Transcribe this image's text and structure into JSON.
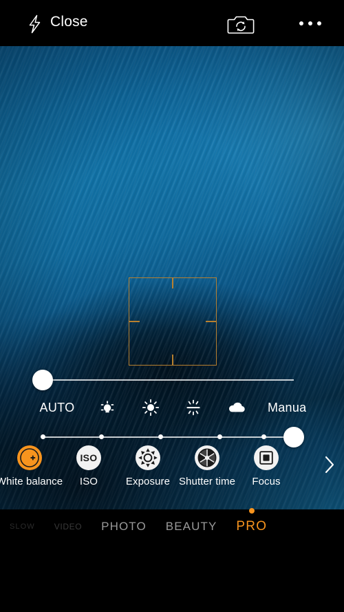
{
  "app": {
    "name": "Camera",
    "mode": "PRO",
    "accent_color": "#f7941e",
    "focus_box_color": "#b8802f",
    "panel_text_color": "#ffffff"
  },
  "topbar": {
    "flash_icon": "flash-off-icon",
    "close_label": "Close",
    "flip_camera_icon": "camera-flip-icon",
    "more_icon": "more-options-icon"
  },
  "viewfinder": {
    "focus_indicator": "focus-square",
    "scene_description": "blurred blue woven fabric"
  },
  "pro_panel": {
    "active_control": "White balance",
    "value_slider": {
      "name": "white-balance-value-slider",
      "thumb_percent": 0,
      "has_dots": false
    },
    "preset_slider": {
      "name": "white-balance-preset-slider",
      "thumb_percent": 100,
      "dot_percents": [
        0,
        23.5,
        47,
        70.5,
        88
      ]
    },
    "wb_scale": [
      {
        "label": "AUTO",
        "type": "text",
        "icon": ""
      },
      {
        "label": "",
        "type": "icon",
        "icon": "incandescent-icon"
      },
      {
        "label": "",
        "type": "icon",
        "icon": "daylight-sun-icon"
      },
      {
        "label": "",
        "type": "icon",
        "icon": "fluorescent-icon"
      },
      {
        "label": "",
        "type": "icon",
        "icon": "cloudy-icon"
      },
      {
        "label": "Manua",
        "type": "text",
        "icon": ""
      }
    ],
    "controls": [
      {
        "label": "White balance",
        "icon": "white-balance-icon",
        "active": true
      },
      {
        "label": "ISO",
        "icon": "iso-icon",
        "active": false
      },
      {
        "label": "Exposure",
        "icon": "exposure-icon",
        "active": false
      },
      {
        "label": "Shutter time",
        "icon": "shutter-time-icon",
        "active": false
      },
      {
        "label": "Focus",
        "icon": "focus-icon",
        "active": false
      }
    ],
    "scroll_more_icon": "chevron-right-icon"
  },
  "modes": [
    {
      "label": "SLOW",
      "state": "faint"
    },
    {
      "label": "VIDEO",
      "state": "dim"
    },
    {
      "label": "PHOTO",
      "state": "normal"
    },
    {
      "label": "BEAUTY",
      "state": "normal"
    },
    {
      "label": "PRO",
      "state": "active"
    }
  ],
  "bottombar": {
    "gallery_thumbnail": "gallery-thumbnail",
    "shutter_button": "shutter-button"
  }
}
